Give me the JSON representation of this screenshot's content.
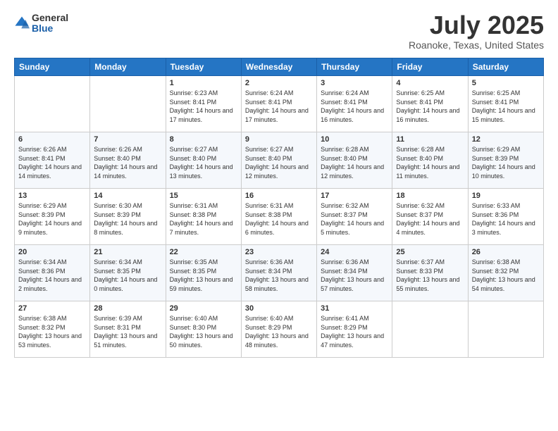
{
  "header": {
    "logo_general": "General",
    "logo_blue": "Blue",
    "month_title": "July 2025",
    "location": "Roanoke, Texas, United States"
  },
  "days_of_week": [
    "Sunday",
    "Monday",
    "Tuesday",
    "Wednesday",
    "Thursday",
    "Friday",
    "Saturday"
  ],
  "weeks": [
    [
      {
        "day": "",
        "info": ""
      },
      {
        "day": "",
        "info": ""
      },
      {
        "day": "1",
        "info": "Sunrise: 6:23 AM\nSunset: 8:41 PM\nDaylight: 14 hours and 17 minutes."
      },
      {
        "day": "2",
        "info": "Sunrise: 6:24 AM\nSunset: 8:41 PM\nDaylight: 14 hours and 17 minutes."
      },
      {
        "day": "3",
        "info": "Sunrise: 6:24 AM\nSunset: 8:41 PM\nDaylight: 14 hours and 16 minutes."
      },
      {
        "day": "4",
        "info": "Sunrise: 6:25 AM\nSunset: 8:41 PM\nDaylight: 14 hours and 16 minutes."
      },
      {
        "day": "5",
        "info": "Sunrise: 6:25 AM\nSunset: 8:41 PM\nDaylight: 14 hours and 15 minutes."
      }
    ],
    [
      {
        "day": "6",
        "info": "Sunrise: 6:26 AM\nSunset: 8:41 PM\nDaylight: 14 hours and 14 minutes."
      },
      {
        "day": "7",
        "info": "Sunrise: 6:26 AM\nSunset: 8:40 PM\nDaylight: 14 hours and 14 minutes."
      },
      {
        "day": "8",
        "info": "Sunrise: 6:27 AM\nSunset: 8:40 PM\nDaylight: 14 hours and 13 minutes."
      },
      {
        "day": "9",
        "info": "Sunrise: 6:27 AM\nSunset: 8:40 PM\nDaylight: 14 hours and 12 minutes."
      },
      {
        "day": "10",
        "info": "Sunrise: 6:28 AM\nSunset: 8:40 PM\nDaylight: 14 hours and 12 minutes."
      },
      {
        "day": "11",
        "info": "Sunrise: 6:28 AM\nSunset: 8:40 PM\nDaylight: 14 hours and 11 minutes."
      },
      {
        "day": "12",
        "info": "Sunrise: 6:29 AM\nSunset: 8:39 PM\nDaylight: 14 hours and 10 minutes."
      }
    ],
    [
      {
        "day": "13",
        "info": "Sunrise: 6:29 AM\nSunset: 8:39 PM\nDaylight: 14 hours and 9 minutes."
      },
      {
        "day": "14",
        "info": "Sunrise: 6:30 AM\nSunset: 8:39 PM\nDaylight: 14 hours and 8 minutes."
      },
      {
        "day": "15",
        "info": "Sunrise: 6:31 AM\nSunset: 8:38 PM\nDaylight: 14 hours and 7 minutes."
      },
      {
        "day": "16",
        "info": "Sunrise: 6:31 AM\nSunset: 8:38 PM\nDaylight: 14 hours and 6 minutes."
      },
      {
        "day": "17",
        "info": "Sunrise: 6:32 AM\nSunset: 8:37 PM\nDaylight: 14 hours and 5 minutes."
      },
      {
        "day": "18",
        "info": "Sunrise: 6:32 AM\nSunset: 8:37 PM\nDaylight: 14 hours and 4 minutes."
      },
      {
        "day": "19",
        "info": "Sunrise: 6:33 AM\nSunset: 8:36 PM\nDaylight: 14 hours and 3 minutes."
      }
    ],
    [
      {
        "day": "20",
        "info": "Sunrise: 6:34 AM\nSunset: 8:36 PM\nDaylight: 14 hours and 2 minutes."
      },
      {
        "day": "21",
        "info": "Sunrise: 6:34 AM\nSunset: 8:35 PM\nDaylight: 14 hours and 0 minutes."
      },
      {
        "day": "22",
        "info": "Sunrise: 6:35 AM\nSunset: 8:35 PM\nDaylight: 13 hours and 59 minutes."
      },
      {
        "day": "23",
        "info": "Sunrise: 6:36 AM\nSunset: 8:34 PM\nDaylight: 13 hours and 58 minutes."
      },
      {
        "day": "24",
        "info": "Sunrise: 6:36 AM\nSunset: 8:34 PM\nDaylight: 13 hours and 57 minutes."
      },
      {
        "day": "25",
        "info": "Sunrise: 6:37 AM\nSunset: 8:33 PM\nDaylight: 13 hours and 55 minutes."
      },
      {
        "day": "26",
        "info": "Sunrise: 6:38 AM\nSunset: 8:32 PM\nDaylight: 13 hours and 54 minutes."
      }
    ],
    [
      {
        "day": "27",
        "info": "Sunrise: 6:38 AM\nSunset: 8:32 PM\nDaylight: 13 hours and 53 minutes."
      },
      {
        "day": "28",
        "info": "Sunrise: 6:39 AM\nSunset: 8:31 PM\nDaylight: 13 hours and 51 minutes."
      },
      {
        "day": "29",
        "info": "Sunrise: 6:40 AM\nSunset: 8:30 PM\nDaylight: 13 hours and 50 minutes."
      },
      {
        "day": "30",
        "info": "Sunrise: 6:40 AM\nSunset: 8:29 PM\nDaylight: 13 hours and 48 minutes."
      },
      {
        "day": "31",
        "info": "Sunrise: 6:41 AM\nSunset: 8:29 PM\nDaylight: 13 hours and 47 minutes."
      },
      {
        "day": "",
        "info": ""
      },
      {
        "day": "",
        "info": ""
      }
    ]
  ]
}
